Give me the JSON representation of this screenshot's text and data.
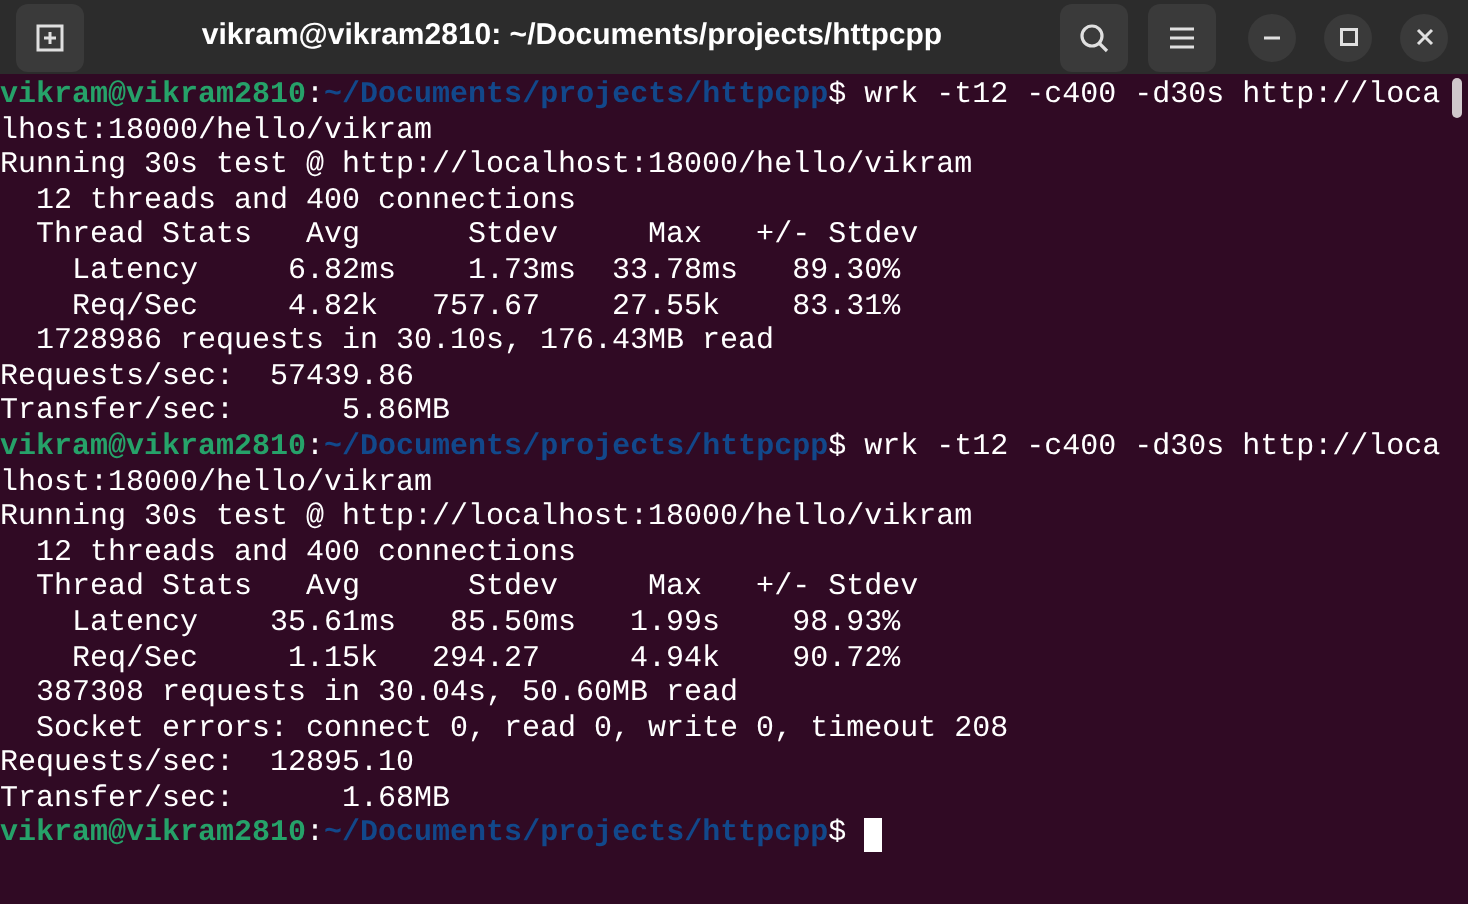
{
  "window": {
    "title": "vikram@vikram2810: ~/Documents/projects/httpcpp"
  },
  "terminal": {
    "lines": [
      {
        "kind": "prompt",
        "user": "vikram@vikram2810",
        "separator": ":",
        "path": "~/Documents/projects/httpcpp",
        "symbol": "$",
        "command": "wrk -t12 -c400 -d30s http://loca",
        "cursor": false
      },
      {
        "kind": "output",
        "text": "lhost:18000/hello/vikram"
      },
      {
        "kind": "output",
        "text": "Running 30s test @ http://localhost:18000/hello/vikram"
      },
      {
        "kind": "output",
        "text": "  12 threads and 400 connections"
      },
      {
        "kind": "output",
        "text": "  Thread Stats   Avg      Stdev     Max   +/- Stdev"
      },
      {
        "kind": "output",
        "text": "    Latency     6.82ms    1.73ms  33.78ms   89.30%"
      },
      {
        "kind": "output",
        "text": "    Req/Sec     4.82k   757.67    27.55k    83.31%"
      },
      {
        "kind": "output",
        "text": "  1728986 requests in 30.10s, 176.43MB read"
      },
      {
        "kind": "output",
        "text": "Requests/sec:  57439.86"
      },
      {
        "kind": "output",
        "text": "Transfer/sec:      5.86MB"
      },
      {
        "kind": "prompt",
        "user": "vikram@vikram2810",
        "separator": ":",
        "path": "~/Documents/projects/httpcpp",
        "symbol": "$",
        "command": "wrk -t12 -c400 -d30s http://loca",
        "cursor": false
      },
      {
        "kind": "output",
        "text": "lhost:18000/hello/vikram"
      },
      {
        "kind": "output",
        "text": "Running 30s test @ http://localhost:18000/hello/vikram"
      },
      {
        "kind": "output",
        "text": "  12 threads and 400 connections"
      },
      {
        "kind": "output",
        "text": "  Thread Stats   Avg      Stdev     Max   +/- Stdev"
      },
      {
        "kind": "output",
        "text": "    Latency    35.61ms   85.50ms   1.99s    98.93%"
      },
      {
        "kind": "output",
        "text": "    Req/Sec     1.15k   294.27     4.94k    90.72%"
      },
      {
        "kind": "output",
        "text": "  387308 requests in 30.04s, 50.60MB read"
      },
      {
        "kind": "output",
        "text": "  Socket errors: connect 0, read 0, write 0, timeout 208"
      },
      {
        "kind": "output",
        "text": "Requests/sec:  12895.10"
      },
      {
        "kind": "output",
        "text": "Transfer/sec:      1.68MB"
      },
      {
        "kind": "prompt",
        "user": "vikram@vikram2810",
        "separator": ":",
        "path": "~/Documents/projects/httpcpp",
        "symbol": "$",
        "cursor": true
      }
    ]
  }
}
